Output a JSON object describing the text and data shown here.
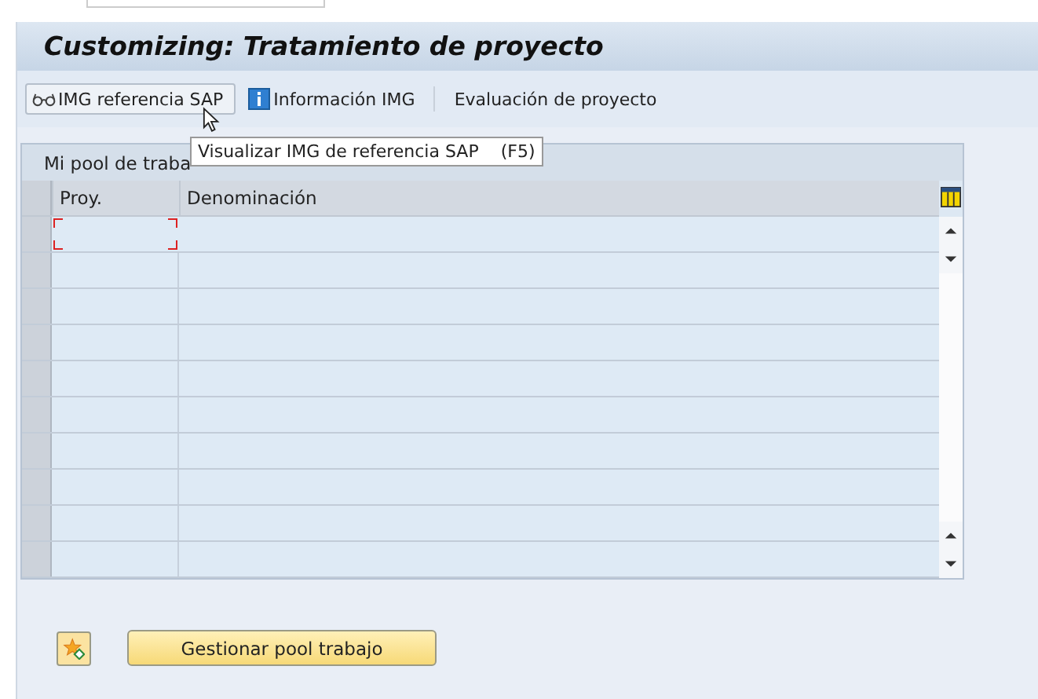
{
  "window": {
    "title": "Customizing: Tratamiento de proyecto"
  },
  "toolbar": [
    {
      "kind": "button",
      "label": "IMG referencia SAP"
    },
    {
      "kind": "link",
      "label": "Información IMG"
    },
    {
      "kind": "link",
      "label": "Evaluación de proyecto"
    }
  ],
  "tooltip": {
    "text": "Visualizar IMG de referencia SAP",
    "key": "(F5)"
  },
  "panel": {
    "title": "Mi pool de traba",
    "table": {
      "columns": [
        "Proy.",
        "Denominación"
      ],
      "rows": [
        {
          "focused": true
        },
        {
          "focused": false
        },
        {
          "focused": false
        },
        {
          "focused": false
        },
        {
          "focused": false
        },
        {
          "focused": false
        },
        {
          "focused": false
        },
        {
          "focused": false
        },
        {
          "focused": false
        },
        {
          "focused": false
        }
      ]
    }
  },
  "footer": {
    "button": "Gestionar pool trabajo"
  }
}
